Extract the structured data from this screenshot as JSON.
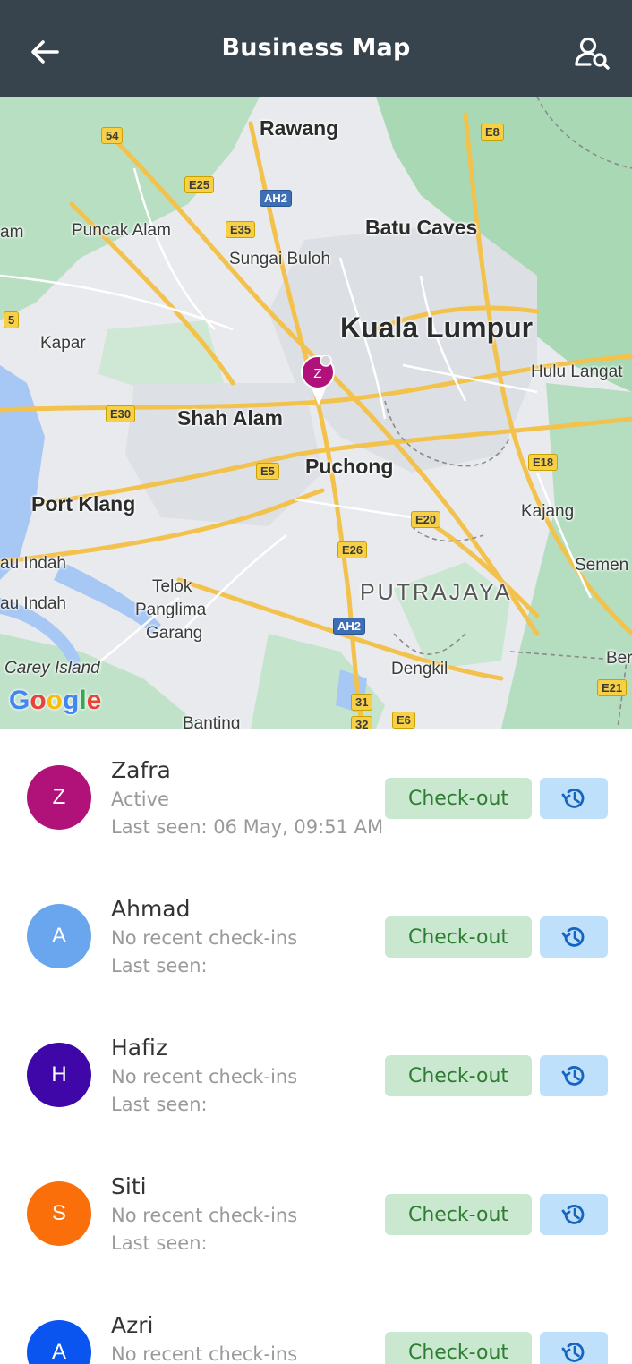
{
  "header": {
    "title": "Business Map",
    "back_icon": "arrow-left-icon",
    "user_search_icon": "user-search-icon",
    "background": "#37434d"
  },
  "map": {
    "labels": {
      "rawang": "Rawang",
      "batu_caves": "Batu Caves",
      "puncak_alam": "Puncak Alam",
      "sungai_buloh": "Sungai Buloh",
      "kuala_lumpur": "Kuala Lumpur",
      "hulu_langat": "Hulu Langat",
      "kapar": "Kapar",
      "shah_alam": "Shah Alam",
      "puchong": "Puchong",
      "port_klang": "Port Klang",
      "kajang": "Kajang",
      "semenyih": "Semen",
      "au_indah_1": "au Indah",
      "au_indah_2": "au Indah",
      "telok_panglima_garang_1": "Telok",
      "telok_panglima_garang_2": "Panglima",
      "telok_panglima_garang_3": "Garang",
      "putrajaya": "PUTRAJAYA",
      "carey_island": "Carey Island",
      "dengkil": "Dengkil",
      "banting": "Banting",
      "beranang": "Ber",
      "am": "am"
    },
    "shields": {
      "s54": "54",
      "e8": "E8",
      "e25": "E25",
      "ah2_top": "AH2",
      "e35": "E35",
      "s5": "5",
      "e30": "E30",
      "e5": "E5",
      "e18": "E18",
      "e20": "E20",
      "e26": "E26",
      "ah2_bottom": "AH2",
      "s31": "31",
      "s32": "32",
      "e6": "E6",
      "e21": "E21"
    },
    "google_logo": "Google",
    "marker_initial": "Z",
    "marker_color": "#b0127a"
  },
  "users": [
    {
      "initial": "Z",
      "name": "Zafra",
      "status": "Active",
      "last_seen": "Last seen: 06 May, 09:51 AM",
      "color": "#b0127a",
      "checkout_label": "Check-out",
      "history_icon": "history-icon"
    },
    {
      "initial": "A",
      "name": "Ahmad",
      "status": "No recent check-ins",
      "last_seen": "Last seen:",
      "color": "#6aa6ee",
      "checkout_label": "Check-out",
      "history_icon": "history-icon"
    },
    {
      "initial": "H",
      "name": "Hafiz",
      "status": "No recent check-ins",
      "last_seen": "Last seen:",
      "color": "#3f07a8",
      "checkout_label": "Check-out",
      "history_icon": "history-icon"
    },
    {
      "initial": "S",
      "name": "Siti",
      "status": "No recent check-ins",
      "last_seen": "Last seen:",
      "color": "#fb6f0a",
      "checkout_label": "Check-out",
      "history_icon": "history-icon"
    },
    {
      "initial": "A",
      "name": "Azri",
      "status": "No recent check-ins",
      "last_seen": "",
      "color": "#0a55f0",
      "checkout_label": "Check-out",
      "history_icon": "history-icon"
    }
  ],
  "colors": {
    "checkout_bg": "#c9e8cf",
    "checkout_text": "#2e7d32",
    "history_bg": "#bfe0fb",
    "history_icon": "#1565c0"
  }
}
